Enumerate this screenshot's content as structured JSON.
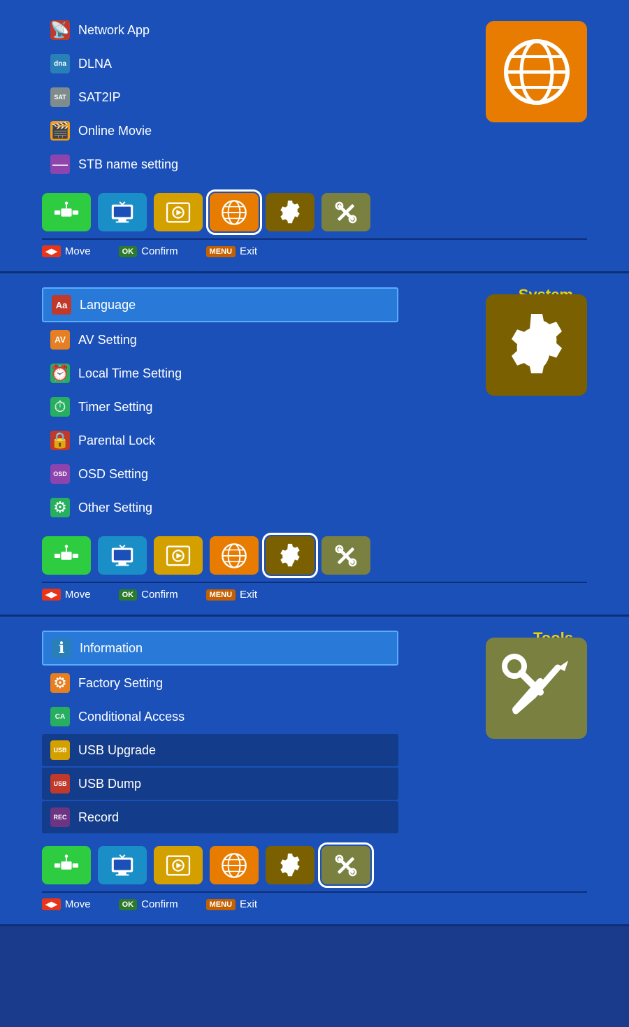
{
  "panels": [
    {
      "id": "network",
      "title": null,
      "bigIconColor": "#e87c00",
      "bigIconType": "globe",
      "items": [
        {
          "label": "Network App",
          "iconColor": "#c0392b",
          "iconText": "📡",
          "active": false,
          "dimmed": false
        },
        {
          "label": "DLNA",
          "iconColor": "#2980b9",
          "iconText": "dna",
          "active": false,
          "dimmed": false
        },
        {
          "label": "SAT2IP",
          "iconColor": "#7f8c8d",
          "iconText": "sat",
          "active": false,
          "dimmed": false
        },
        {
          "label": "Online Movie",
          "iconColor": "#f39c12",
          "iconText": "🎬",
          "active": false,
          "dimmed": false
        },
        {
          "label": "STB name setting",
          "iconColor": "#8e44ad",
          "iconText": "—",
          "active": false,
          "dimmed": false
        }
      ],
      "navActive": 3,
      "bottomBtns": [
        {
          "labelText": "◀▶",
          "labelClass": "btn-label",
          "text": "Move"
        },
        {
          "labelText": "OK",
          "labelClass": "btn-label ok",
          "text": "Confirm"
        },
        {
          "labelText": "MENU",
          "labelClass": "btn-label menu",
          "text": "Exit"
        }
      ]
    },
    {
      "id": "system",
      "title": "System",
      "bigIconColor": "#7a6000",
      "bigIconType": "gear",
      "items": [
        {
          "label": "Language",
          "iconColor": "#c0392b",
          "iconText": "Aa",
          "active": true,
          "dimmed": false
        },
        {
          "label": "AV Setting",
          "iconColor": "#e67e22",
          "iconText": "AV",
          "active": false,
          "dimmed": false
        },
        {
          "label": "Local Time Setting",
          "iconColor": "#27ae60",
          "iconText": "⏰",
          "active": false,
          "dimmed": false
        },
        {
          "label": "Timer Setting",
          "iconColor": "#27ae60",
          "iconText": "⏱",
          "active": false,
          "dimmed": false
        },
        {
          "label": "Parental Lock",
          "iconColor": "#c0392b",
          "iconText": "🔒",
          "active": false,
          "dimmed": false
        },
        {
          "label": "OSD Setting",
          "iconColor": "#8e44ad",
          "iconText": "OSD",
          "active": false,
          "dimmed": false
        },
        {
          "label": "Other Setting",
          "iconColor": "#27ae60",
          "iconText": "⚙",
          "active": false,
          "dimmed": false
        }
      ],
      "navActive": 4,
      "bottomBtns": [
        {
          "labelText": "◀▶",
          "labelClass": "btn-label",
          "text": "Move"
        },
        {
          "labelText": "OK",
          "labelClass": "btn-label ok",
          "text": "Confirm"
        },
        {
          "labelText": "MENU",
          "labelClass": "btn-label menu",
          "text": "Exit"
        }
      ]
    },
    {
      "id": "tools",
      "title": "Tools",
      "bigIconColor": "#7a8040",
      "bigIconType": "tools",
      "items": [
        {
          "label": "Information",
          "iconColor": "#2980b9",
          "iconText": "ℹ",
          "active": true,
          "dimmed": false
        },
        {
          "label": "Factory Setting",
          "iconColor": "#e67e22",
          "iconText": "⚙",
          "active": false,
          "dimmed": false
        },
        {
          "label": "Conditional Access",
          "iconColor": "#27ae60",
          "iconText": "CA",
          "active": false,
          "dimmed": false
        },
        {
          "label": "USB Upgrade",
          "iconColor": "#d4a000",
          "iconText": "USB",
          "active": false,
          "dimmed": true
        },
        {
          "label": "USB Dump",
          "iconColor": "#c0392b",
          "iconText": "USB",
          "active": false,
          "dimmed": true
        },
        {
          "label": "Record",
          "iconColor": "#6c3483",
          "iconText": "REC",
          "active": false,
          "dimmed": true
        }
      ],
      "navActive": 5,
      "bottomBtns": [
        {
          "labelText": "◀▶",
          "labelClass": "btn-label",
          "text": "Move"
        },
        {
          "labelText": "OK",
          "labelClass": "btn-label ok",
          "text": "Confirm"
        },
        {
          "labelText": "MENU",
          "labelClass": "btn-label menu",
          "text": "Exit"
        }
      ]
    }
  ],
  "navIcons": [
    {
      "color": "#2ecc40",
      "type": "satellite",
      "label": "satellite-nav"
    },
    {
      "color": "#1a8fc7",
      "type": "tv",
      "label": "tv-nav"
    },
    {
      "color": "#d4a000",
      "type": "media",
      "label": "media-nav"
    },
    {
      "color": "#e87c00",
      "type": "globe",
      "label": "globe-nav"
    },
    {
      "color": "#7a6000",
      "type": "gear",
      "label": "gear-nav"
    },
    {
      "color": "#7a8040",
      "type": "tools",
      "label": "tools-nav"
    }
  ]
}
